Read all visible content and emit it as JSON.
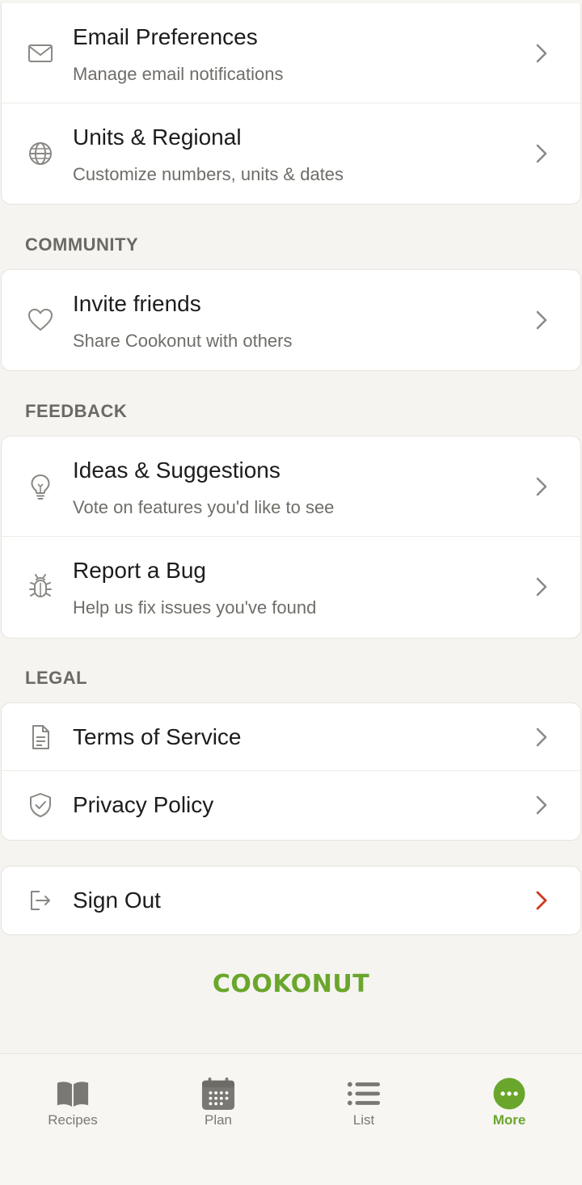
{
  "sections": {
    "account_group": {
      "items": [
        {
          "title": "Email Preferences",
          "subtitle": "Manage email notifications",
          "icon": "mail-icon"
        },
        {
          "title": "Units & Regional",
          "subtitle": "Customize numbers, units & dates",
          "icon": "globe-icon"
        }
      ]
    },
    "community": {
      "header": "COMMUNITY",
      "items": [
        {
          "title": "Invite friends",
          "subtitle": "Share Cookonut with others",
          "icon": "heart-icon"
        }
      ]
    },
    "feedback": {
      "header": "FEEDBACK",
      "items": [
        {
          "title": "Ideas & Suggestions",
          "subtitle": "Vote on features you'd like to see",
          "icon": "lightbulb-icon"
        },
        {
          "title": "Report a Bug",
          "subtitle": "Help us fix issues you've found",
          "icon": "bug-icon"
        }
      ]
    },
    "legal": {
      "header": "LEGAL",
      "items": [
        {
          "title": "Terms of Service",
          "icon": "document-icon"
        },
        {
          "title": "Privacy Policy",
          "icon": "shield-check-icon"
        }
      ]
    },
    "sign_out": {
      "title": "Sign Out",
      "icon": "sign-out-icon",
      "chevron_color": "#d0381f"
    }
  },
  "brand": {
    "logo_text": "COOKONUT",
    "color": "#6aa62c"
  },
  "tabbar": {
    "tabs": [
      {
        "label": "Recipes",
        "icon": "book-icon",
        "active": false
      },
      {
        "label": "Plan",
        "icon": "calendar-icon",
        "active": false
      },
      {
        "label": "List",
        "icon": "list-icon",
        "active": false
      },
      {
        "label": "More",
        "icon": "more-dots-icon",
        "active": true
      }
    ],
    "active_color": "#6aa62c",
    "inactive_color": "#7a7873"
  }
}
